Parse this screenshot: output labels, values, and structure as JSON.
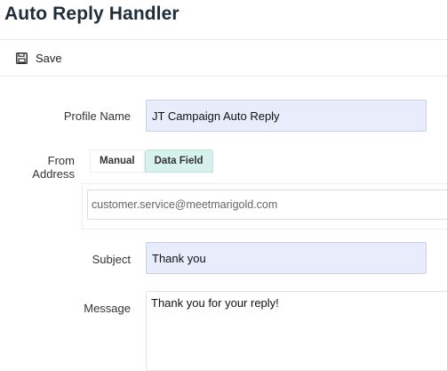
{
  "page": {
    "title": "Auto Reply Handler"
  },
  "toolbar": {
    "save_label": "Save",
    "save_icon": "floppy-disk-icon"
  },
  "form": {
    "profile_name": {
      "label": "Profile Name",
      "value": "JT Campaign Auto Reply"
    },
    "from_address": {
      "label_line1": "From",
      "label_line2": "Address",
      "tabs": [
        {
          "label": "Manual",
          "selected": false
        },
        {
          "label": "Data Field",
          "selected": true
        }
      ],
      "value": "customer.service@meetmarigold.com"
    },
    "subject": {
      "label": "Subject",
      "value": "Thank you"
    },
    "message": {
      "label": "Message",
      "value": "Thank you for your reply!"
    }
  },
  "colors": {
    "filled_input_bg": "#e8ecfb",
    "selected_tab_bg": "#d7f1ec",
    "title_color": "#1f2d3a"
  }
}
